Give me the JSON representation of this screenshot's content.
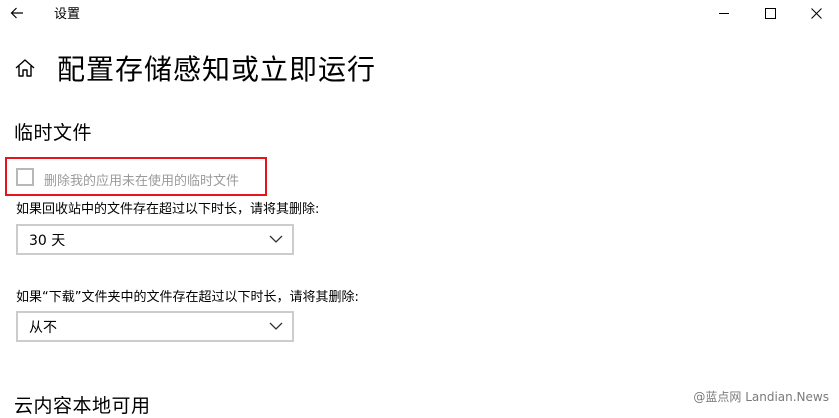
{
  "window": {
    "title": "设置",
    "back_icon": "back-arrow-icon",
    "minimize_icon": "minimize-icon",
    "maximize_icon": "maximize-icon",
    "close_icon": "close-icon"
  },
  "header": {
    "home_icon": "home-icon",
    "page_title": "配置存储感知或立即运行"
  },
  "temp_files": {
    "section_title": "临时文件",
    "checkbox_label": "删除我的应用未在使用的临时文件",
    "checkbox_checked": false,
    "highlight_color": "#e8141c",
    "recycle_bin_label": "如果回收站中的文件存在超过以下时长，请将其删除:",
    "recycle_bin_value": "30 天",
    "downloads_label": "如果“下载”文件夹中的文件存在超过以下时长，请将其删除:",
    "downloads_value": "从不"
  },
  "cloud": {
    "section_title": "云内容本地可用"
  },
  "watermark": {
    "text": "@蓝点网 Landian.News"
  }
}
